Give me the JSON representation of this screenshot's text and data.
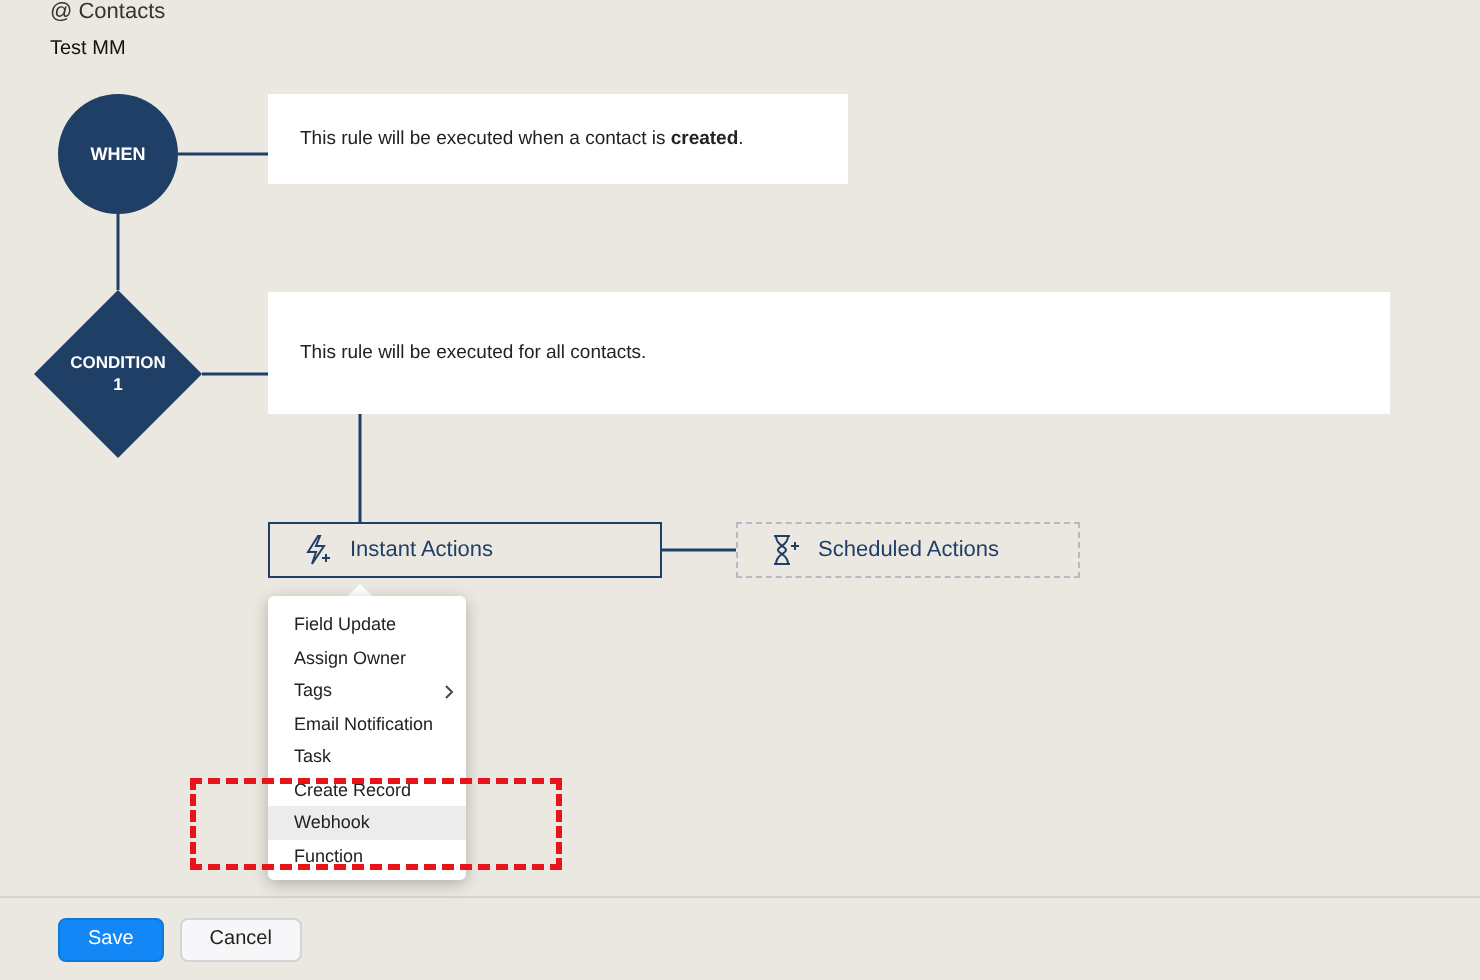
{
  "breadcrumb": "@ Contacts",
  "rule_name": "Test MM",
  "when": {
    "label": "WHEN",
    "text": "This rule will be executed when a contact is **created**."
  },
  "condition": {
    "label": "CONDITION",
    "number": "1",
    "text": "This rule will be executed for all contacts."
  },
  "actions": [
    {
      "label": "Instant Actions",
      "kind": "instant"
    },
    {
      "label": "Scheduled Actions",
      "kind": "scheduled"
    }
  ],
  "menu": {
    "items": [
      {
        "label": "Field Update",
        "selected": false,
        "submenu": false
      },
      {
        "label": "Assign Owner",
        "selected": false,
        "submenu": false
      },
      {
        "label": "Tags",
        "selected": false,
        "submenu": true
      },
      {
        "label": "Email Notification",
        "selected": false,
        "submenu": false
      },
      {
        "label": "Task",
        "selected": false,
        "submenu": false
      },
      {
        "label": "Create Record",
        "selected": false,
        "submenu": false
      },
      {
        "label": "Webhook",
        "selected": true,
        "submenu": false
      },
      {
        "label": "Function",
        "selected": false,
        "submenu": false
      }
    ]
  },
  "footer": {
    "buttons": [
      {
        "label": "Save",
        "kind": "primary"
      },
      {
        "label": "Cancel",
        "kind": "secondary"
      }
    ]
  }
}
